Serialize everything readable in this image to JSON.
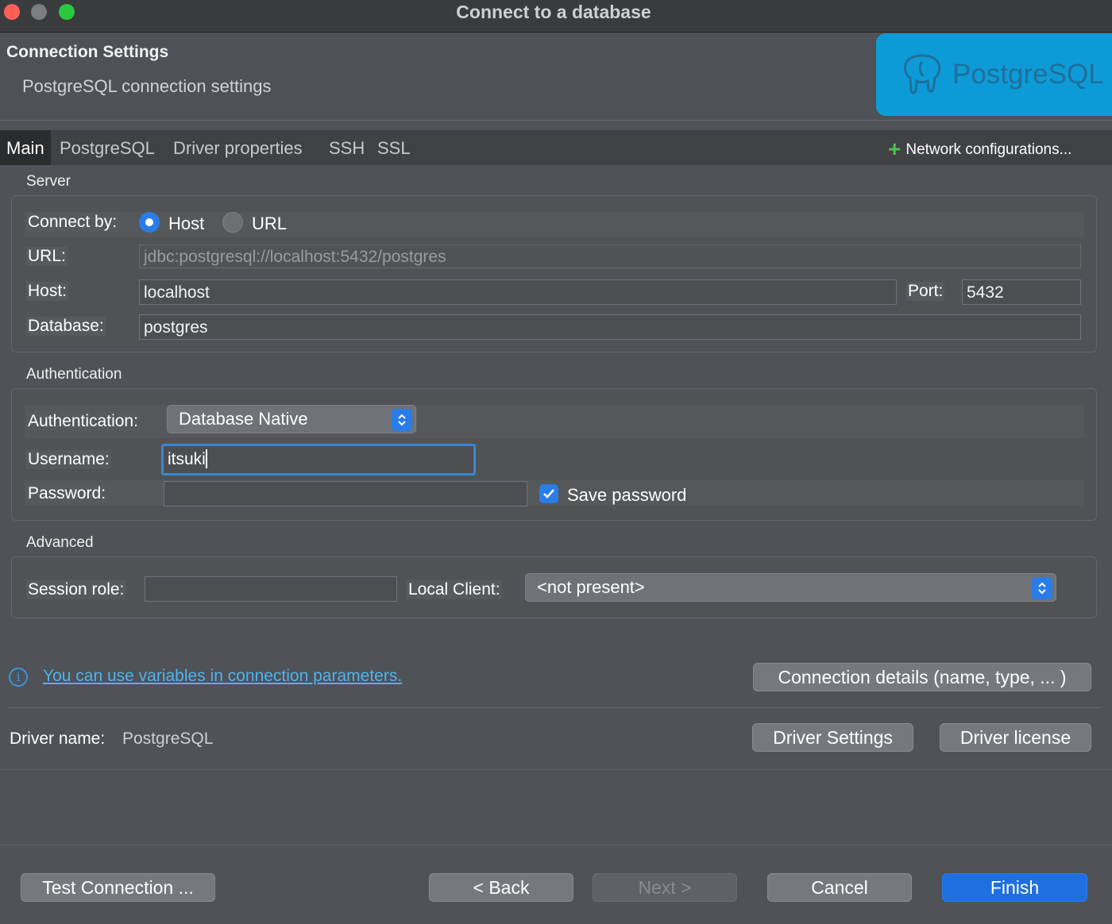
{
  "window": {
    "title": "Connect to a database"
  },
  "header": {
    "title": "Connection Settings",
    "subtitle": "PostgreSQL connection settings",
    "logo_text": "PostgreSQL"
  },
  "tabs": [
    {
      "label": "Main",
      "active": true
    },
    {
      "label": "PostgreSQL"
    },
    {
      "label": "Driver properties"
    },
    {
      "label": "SSH"
    },
    {
      "label": "SSL"
    }
  ],
  "network_config": {
    "label": "Network configurations..."
  },
  "server": {
    "section_label": "Server",
    "connect_by_label": "Connect by:",
    "host_option": "Host",
    "url_option": "URL",
    "selected": "Host",
    "url_label": "URL:",
    "url_value": "jdbc:postgresql://localhost:5432/postgres",
    "host_label": "Host:",
    "host_value": "localhost",
    "port_label": "Port:",
    "port_value": "5432",
    "database_label": "Database:",
    "database_value": "postgres"
  },
  "auth": {
    "section_label": "Authentication",
    "auth_label": "Authentication:",
    "auth_value": "Database Native",
    "username_label": "Username:",
    "username_value": "itsuki",
    "password_label": "Password:",
    "password_value": "",
    "save_password_label": "Save password",
    "save_password_checked": true
  },
  "advanced": {
    "section_label": "Advanced",
    "session_role_label": "Session role:",
    "session_role_value": "",
    "local_client_label": "Local Client:",
    "local_client_value": "<not present>"
  },
  "info": {
    "variables_link": "You can use variables in connection parameters.",
    "connection_details_button": "Connection details (name, type, ... )"
  },
  "driver": {
    "name_label": "Driver name:",
    "name_value": "PostgreSQL",
    "settings_button": "Driver Settings",
    "license_button": "Driver license"
  },
  "footer": {
    "test_button": "Test Connection ...",
    "back_button": "< Back",
    "next_button": "Next >",
    "cancel_button": "Cancel",
    "finish_button": "Finish"
  },
  "colors": {
    "accent": "#2a7ce8",
    "logo_bg": "#0d9bd7",
    "link": "#4fb3f0",
    "close": "#fe5f57",
    "maximize": "#28c840"
  }
}
